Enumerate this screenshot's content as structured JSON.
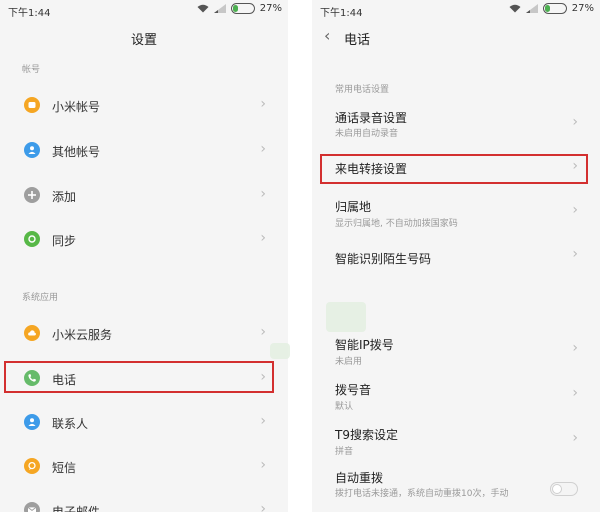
{
  "left": {
    "status": {
      "time": "下午1:44",
      "battery": "27%",
      "battery_level": 0.27
    },
    "title": "设置",
    "sections": [
      {
        "header": "帐号",
        "items": [
          {
            "label": "小米帐号",
            "icon": "mi-account-icon",
            "color": "#f5a623"
          },
          {
            "label": "其他帐号",
            "icon": "person-icon",
            "color": "#3d9be9"
          },
          {
            "label": "添加",
            "icon": "plus-icon",
            "color": "#9e9e9e"
          },
          {
            "label": "同步",
            "icon": "sync-icon",
            "color": "#57b847"
          }
        ]
      },
      {
        "header": "系统应用",
        "items": [
          {
            "label": "小米云服务",
            "icon": "cloud-icon",
            "color": "#f5a623"
          },
          {
            "label": "电话",
            "icon": "phone-icon",
            "color": "#66bb6a"
          },
          {
            "label": "联系人",
            "icon": "contacts-icon",
            "color": "#3d9be9"
          },
          {
            "label": "短信",
            "icon": "message-icon",
            "color": "#f5a623"
          },
          {
            "label": "电子邮件",
            "icon": "mail-icon",
            "color": "#9e9e9e"
          }
        ]
      }
    ]
  },
  "right": {
    "status": {
      "time": "下午1:44",
      "battery": "27%"
    },
    "title": "电话",
    "section1_header": "常用电话设置",
    "items": [
      {
        "label": "通话录音设置",
        "sub": "未启用自动录音"
      },
      {
        "label": "来电转接设置",
        "sub": ""
      },
      {
        "label": "归属地",
        "sub": "显示归属地, 不自动加拨国家码"
      },
      {
        "label": "智能识别陌生号码",
        "sub": ""
      },
      {
        "label": "智能IP拨号",
        "sub": "未启用"
      },
      {
        "label": "拨号音",
        "sub": "默认"
      },
      {
        "label": "T9搜索设定",
        "sub": "拼音"
      },
      {
        "label": "自动重拨",
        "sub": "拨打电话未接通，系统自动重拨10次，手动"
      }
    ],
    "accent": "#d32f2f"
  }
}
